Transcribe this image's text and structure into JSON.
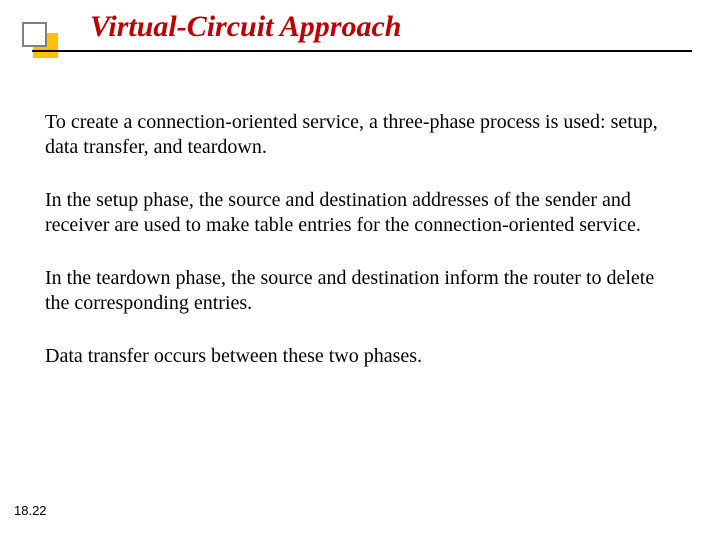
{
  "title": "Virtual-Circuit Approach",
  "paragraphs": [
    "To create a connection-oriented service, a three-phase process is used: setup, data transfer, and teardown.",
    "In the setup phase, the source and destination addresses of the sender and receiver are used to make table entries for the connection-oriented service.",
    "In the teardown phase, the source and destination inform the router to delete the corresponding entries.",
    "Data transfer occurs between these two phases."
  ],
  "pageNumber": "18.22"
}
